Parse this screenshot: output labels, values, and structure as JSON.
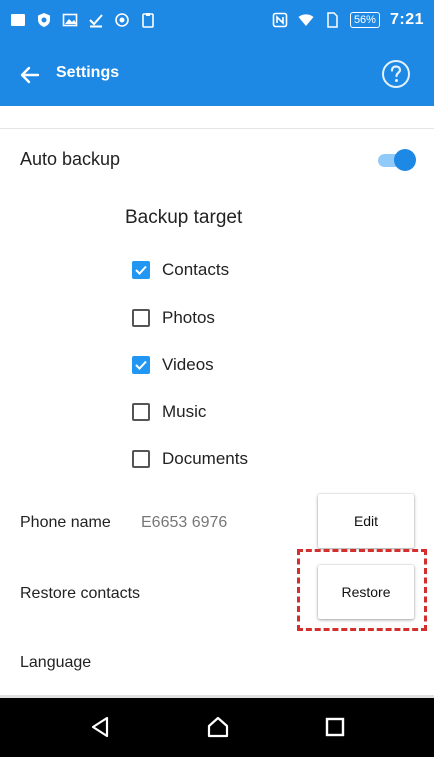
{
  "status_bar": {
    "battery_level": "56%",
    "time": "7:21",
    "icons_left": [
      "notification-square-icon",
      "shield-icon",
      "image-icon",
      "download-check-icon",
      "shield-small-icon",
      "clipboard-icon"
    ],
    "icons_right": [
      "nfc-icon",
      "wifi-icon",
      "sim-icon",
      "battery-icon"
    ]
  },
  "app_bar": {
    "title": "Settings",
    "back_icon": "arrow-left-icon",
    "help_icon": "help-circle-icon",
    "color": "#1e88e5"
  },
  "settings": {
    "auto_backup": {
      "label": "Auto backup",
      "enabled": true
    },
    "backup_target": {
      "title": "Backup target",
      "items": [
        {
          "label": "Contacts",
          "checked": true
        },
        {
          "label": "Photos",
          "checked": false
        },
        {
          "label": "Videos",
          "checked": true
        },
        {
          "label": "Music",
          "checked": false
        },
        {
          "label": "Documents",
          "checked": false
        }
      ]
    },
    "phone_name": {
      "label": "Phone name",
      "value": "E6653 6976",
      "button": "Edit"
    },
    "restore_contacts": {
      "label": "Restore contacts",
      "button": "Restore"
    },
    "language": {
      "label": "Language"
    }
  },
  "highlight_color": "#d32f2f",
  "nav_bar": {
    "icons": [
      "back-triangle-icon",
      "home-icon",
      "recents-icon"
    ]
  }
}
